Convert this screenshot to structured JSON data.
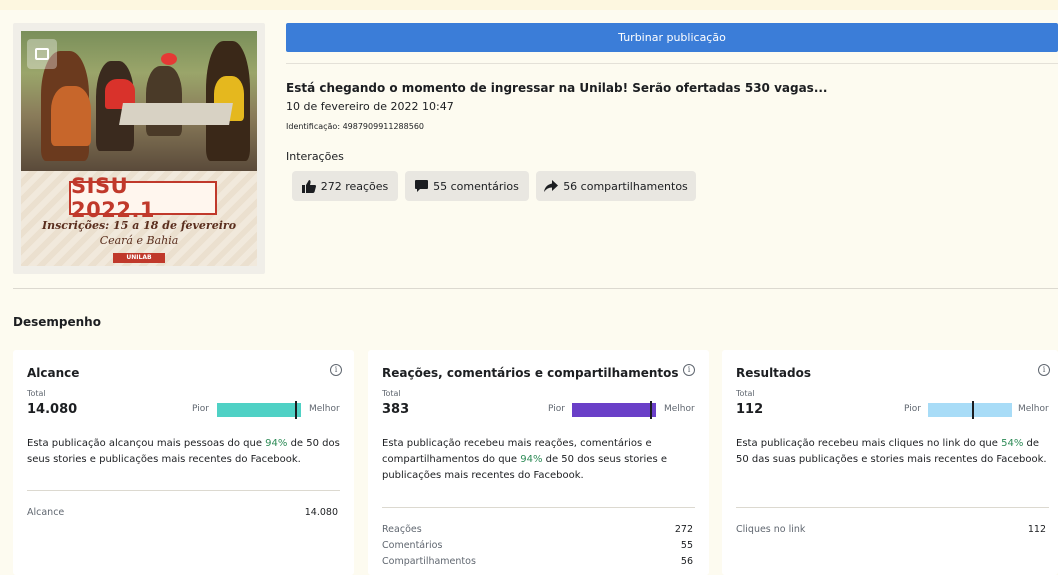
{
  "post": {
    "boost_label": "Turbinar publicação",
    "title": "Está chegando o momento de ingressar na Unilab! Serão ofertadas 530 vagas...",
    "date": "10 de fevereiro de 2022 10:47",
    "id_text": "Identificação: 4987909911288560",
    "interactions_label": "Interações",
    "chips": [
      {
        "label": "272 reações",
        "icon": "thumbs-up-icon"
      },
      {
        "label": "55 comentários",
        "icon": "comment-icon"
      },
      {
        "label": "56 compartilhamentos",
        "icon": "share-icon"
      }
    ],
    "image": {
      "headline": "SISU 2022.1",
      "subtitle": "Inscrições: 15 a 18 de fevereiro",
      "places": "Ceará e Bahia",
      "logo": "UNILAB"
    }
  },
  "performance": {
    "title": "Desempenho",
    "cards": [
      {
        "title": "Alcance",
        "total_label": "Total",
        "total": "14.080",
        "worse": "Pior",
        "better": "Melhor",
        "bar_color": "#4fd1c5",
        "percentile": 94,
        "desc_prefix": "Esta publicação alcançou mais pessoas do que ",
        "desc_pct": "94%",
        "desc_suffix": " de 50 dos seus stories e publicações mais recentes do Facebook.",
        "rows": [
          {
            "label": "Alcance",
            "value": "14.080"
          }
        ]
      },
      {
        "title": "Reações, comentários e compartilhamentos",
        "total_label": "Total",
        "total": "383",
        "worse": "Pior",
        "better": "Melhor",
        "bar_color": "#6a3fc8",
        "percentile": 94,
        "desc_prefix": "Esta publicação recebeu mais reações, comentários e compartilhamentos do que ",
        "desc_pct": "94%",
        "desc_suffix": " de 50 dos seus stories e publicações mais recentes do Facebook.",
        "rows": [
          {
            "label": "Reações",
            "value": "272"
          },
          {
            "label": "Comentários",
            "value": "55"
          },
          {
            "label": "Compartilhamentos",
            "value": "56"
          }
        ]
      },
      {
        "title": "Resultados",
        "total_label": "Total",
        "total": "112",
        "worse": "Pior",
        "better": "Melhor",
        "bar_color": "#a8dcf7",
        "percentile": 54,
        "desc_prefix": "Esta publicação recebeu mais cliques no link do que ",
        "desc_pct": "54%",
        "desc_suffix": " de 50 das suas publicações e stories mais recentes do Facebook.",
        "rows": [
          {
            "label": "Cliques no link",
            "value": "112"
          }
        ]
      }
    ]
  }
}
